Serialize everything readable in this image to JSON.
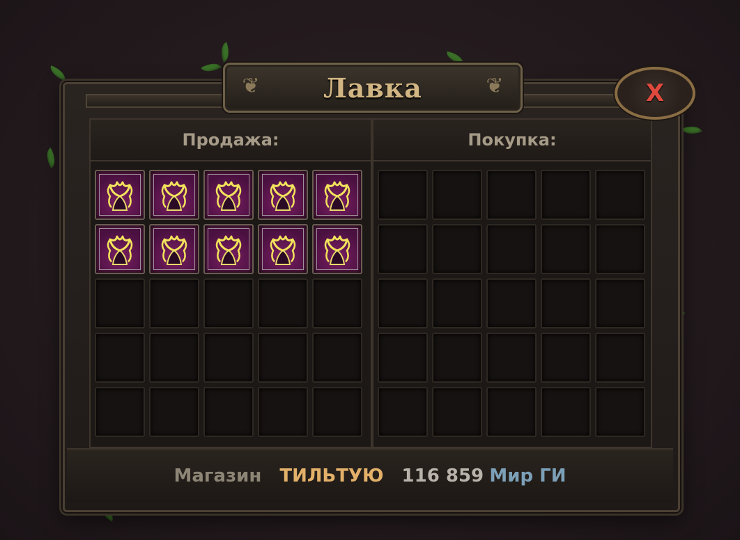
{
  "window": {
    "title": "Лавка",
    "close_label": "X"
  },
  "sell_panel": {
    "header": "Продажа:",
    "rows": 5,
    "cols": 5,
    "filled_count": 10,
    "item_icon": "magenta-golden-totem-icon"
  },
  "buy_panel": {
    "header": "Покупка:",
    "rows": 5,
    "cols": 5,
    "filled_count": 0
  },
  "footer": {
    "label": "Магазин",
    "shop_name": "ТИЛЬТУЮ",
    "amount": "116 859",
    "currency": "Мир ГИ"
  },
  "colors": {
    "title": "#d1b583",
    "close": "#e0493e",
    "shop_name": "#e2b069",
    "currency": "#7ca0b7",
    "item_bg": "#7a1f63"
  }
}
